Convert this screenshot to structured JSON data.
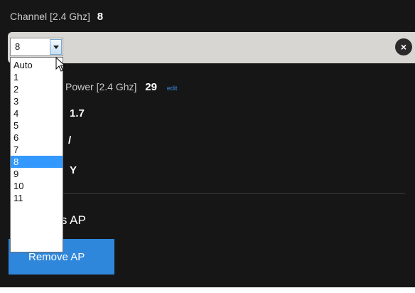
{
  "channel": {
    "label": "Channel [2.4 Ghz]",
    "value": "8"
  },
  "tx_power": {
    "label": "Power [2.4 Ghz]",
    "value": "29",
    "edit_link": "edit"
  },
  "firmware": {
    "value": "1.7"
  },
  "row3": {
    "value": "Y"
  },
  "forget": {
    "label_visible": "this AP"
  },
  "remove_button": {
    "label": "Remove AP"
  },
  "channel_select": {
    "selected": "8",
    "options": [
      "Auto",
      "1",
      "2",
      "3",
      "4",
      "5",
      "6",
      "7",
      "8",
      "9",
      "10",
      "11"
    ]
  },
  "clear_button": {
    "icon": "close-icon",
    "glyph": "×"
  },
  "colors": {
    "panel_bg": "#161616",
    "accent_blue": "#2f87dc",
    "selection_blue": "#3399ff",
    "edit_bar": "#d8d6d2"
  }
}
